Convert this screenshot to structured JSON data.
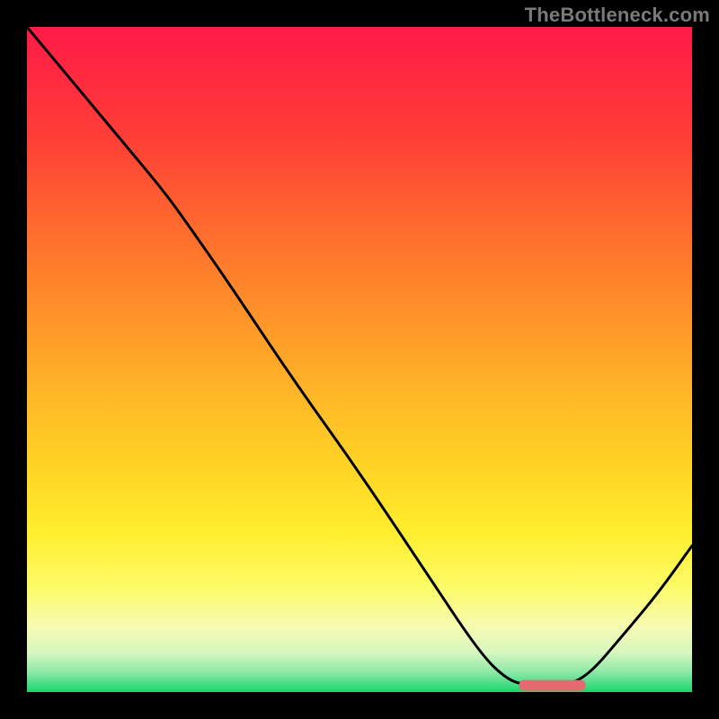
{
  "watermark": "TheBottleneck.com",
  "chart_data": {
    "type": "line",
    "title": "",
    "xlabel": "",
    "ylabel": "",
    "xlim": [
      0,
      100
    ],
    "ylim": [
      0,
      100
    ],
    "series": [
      {
        "name": "curve",
        "x": [
          0,
          5,
          10,
          15,
          20,
          23,
          30,
          40,
          50,
          60,
          68,
          72,
          75,
          80,
          84,
          90,
          95,
          100
        ],
        "y": [
          100,
          94,
          88,
          82,
          76,
          72,
          62,
          47,
          33,
          18,
          6,
          2,
          1,
          1,
          2,
          9,
          15,
          22
        ]
      }
    ],
    "marker": {
      "name": "optimal-zone",
      "x_start": 74,
      "x_end": 84,
      "y": 1,
      "color": "#e46a6f"
    },
    "background_gradient": {
      "top": "#ff1a47",
      "mid": "#ffd324",
      "bottom": "#19d66e"
    }
  }
}
